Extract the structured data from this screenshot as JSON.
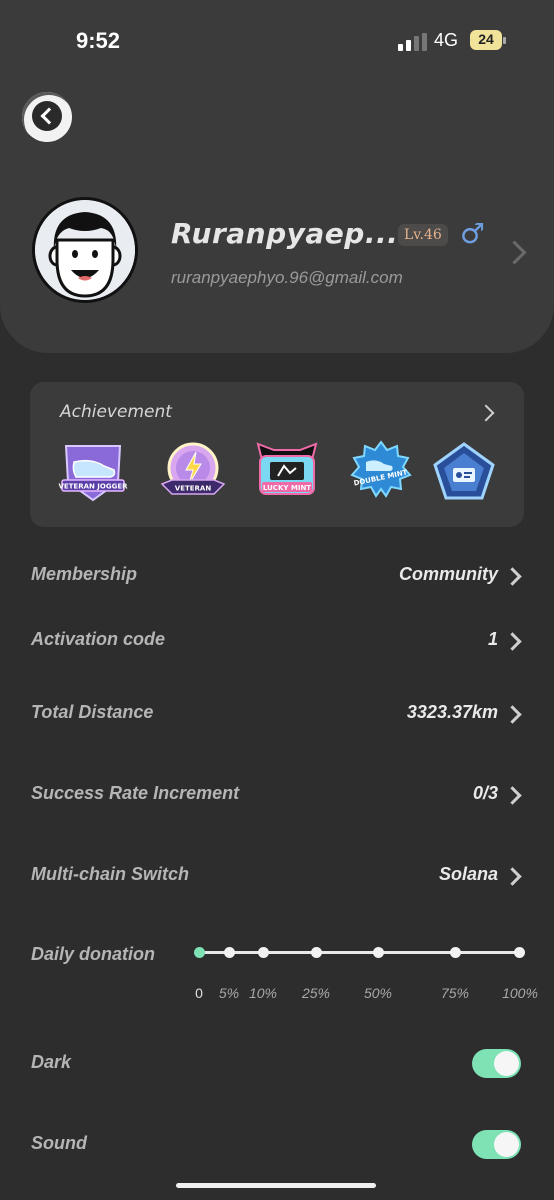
{
  "status_bar": {
    "time": "9:52",
    "network": "4G",
    "battery": "24"
  },
  "profile": {
    "name": "Ruranpyaep...",
    "level": "Lv.46",
    "gender_symbol": "♂",
    "email": "ruranpyaephyo.96@gmail.com"
  },
  "achievement": {
    "title": "Achievement",
    "badges": [
      {
        "name": "VETERAN JOGGER",
        "icon": "shoe-badge-icon"
      },
      {
        "name": "VETERAN",
        "icon": "lightning-badge-icon"
      },
      {
        "name": "LUCKY MINT",
        "icon": "ticket-badge-icon"
      },
      {
        "name": "DOUBLE MINT",
        "icon": "shoes-badge-icon"
      },
      {
        "name": "",
        "icon": "pentagon-badge-icon"
      }
    ]
  },
  "settings": {
    "membership": {
      "label": "Membership",
      "value": "Community"
    },
    "activation": {
      "label": "Activation code",
      "value": "1"
    },
    "distance": {
      "label": "Total Distance",
      "value": "3323.37km"
    },
    "success_rate": {
      "label": "Success Rate Increment",
      "value": "0/3"
    },
    "multichain": {
      "label": "Multi-chain Switch",
      "value": "Solana"
    }
  },
  "donation": {
    "label": "Daily donation",
    "ticks": [
      "0",
      "5%",
      "10%",
      "25%",
      "50%",
      "75%",
      "100%"
    ],
    "selected_percent": 0
  },
  "toggles": {
    "dark": {
      "label": "Dark",
      "on": true
    },
    "sound": {
      "label": "Sound",
      "on": true
    }
  },
  "colors": {
    "accent": "#7ee2b4",
    "background": "#2d2d2d",
    "card": "#3b3b3b"
  }
}
